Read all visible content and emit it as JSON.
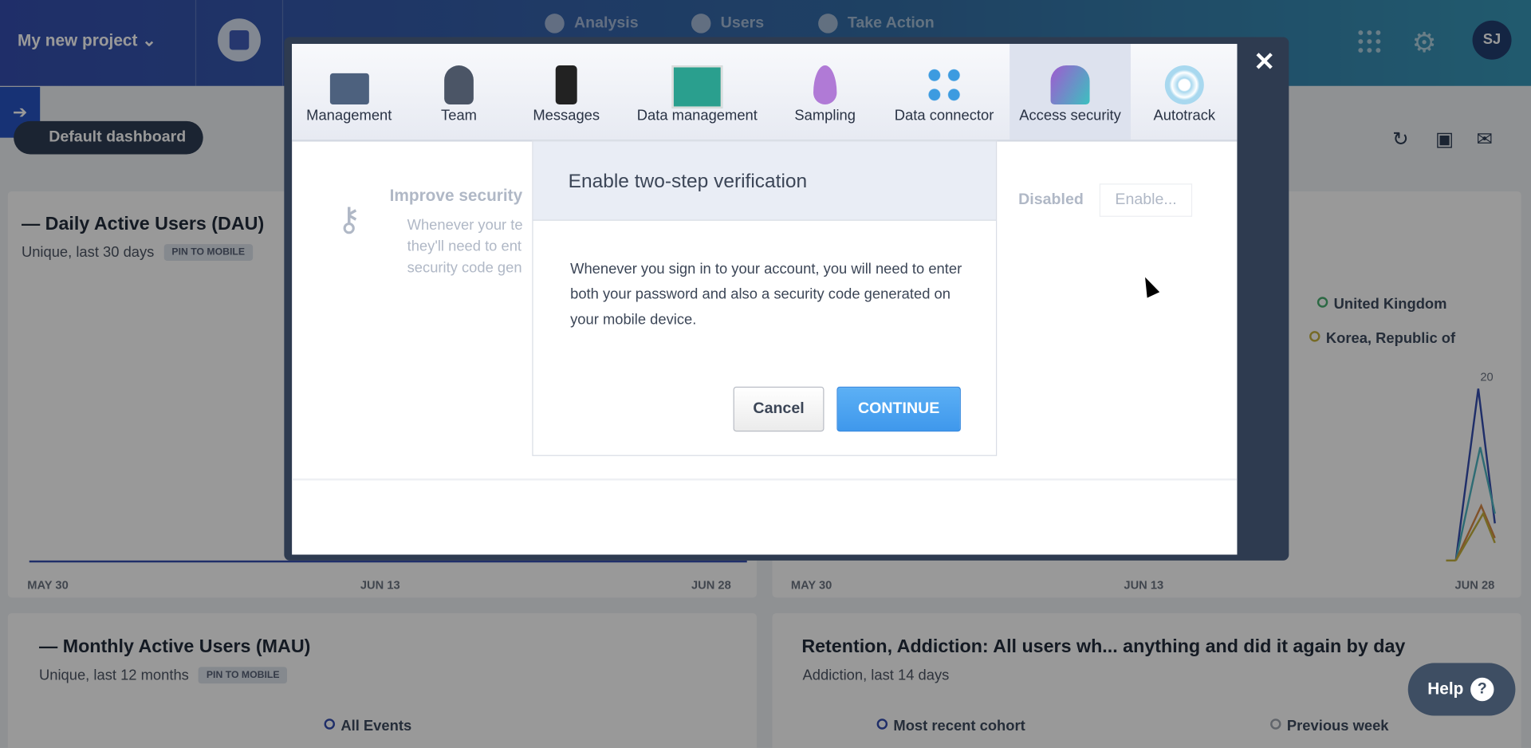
{
  "header": {
    "project": "My new project",
    "nav": [
      "Analysis",
      "Users",
      "Take Action"
    ],
    "avatar": "SJ"
  },
  "dashboard": {
    "button": "Default dashboard"
  },
  "cards": {
    "dau": {
      "title": "Daily Active Users (DAU)",
      "subtitle": "Unique, last 30 days",
      "pin": "PIN TO MOBILE",
      "x_ticks": [
        "MAY 30",
        "JUN 13",
        "JUN 28"
      ]
    },
    "geo": {
      "legend": [
        {
          "label": "United Kingdom",
          "color": "#3cb36b"
        },
        {
          "label": "Korea, Republic of",
          "color": "#c9b22a"
        }
      ],
      "peak_label": "20",
      "x_ticks": [
        "MAY 30",
        "JUN 13",
        "JUN 28"
      ]
    },
    "mau": {
      "title": "Monthly Active Users (MAU)",
      "subtitle": "Unique, last 12 months",
      "pin": "PIN TO MOBILE",
      "legend": "All Events"
    },
    "retention": {
      "title": "Retention, Addiction: All users wh... anything and did it again by day",
      "subtitle": "Addiction, last 14 days",
      "legend": [
        "Most recent cohort",
        "Previous week"
      ]
    }
  },
  "modal": {
    "tabs": [
      {
        "label": "Management"
      },
      {
        "label": "Team"
      },
      {
        "label": "Messages"
      },
      {
        "label": "Data management"
      },
      {
        "label": "Sampling"
      },
      {
        "label": "Data connector"
      },
      {
        "label": "Access security",
        "active": true
      },
      {
        "label": "Autotrack"
      }
    ],
    "background": {
      "title": "Improve security",
      "text": [
        "Whenever your te",
        "they'll need to ent",
        "security code gen"
      ],
      "status": "Disabled",
      "enable": "Enable..."
    }
  },
  "dialog": {
    "title": "Enable two-step verification",
    "body": "Whenever you sign in to your account, you will need to enter both your password and also a security code generated on your mobile device.",
    "cancel": "Cancel",
    "continue": "CONTINUE"
  },
  "help": {
    "label": "Help",
    "icon": "?"
  }
}
